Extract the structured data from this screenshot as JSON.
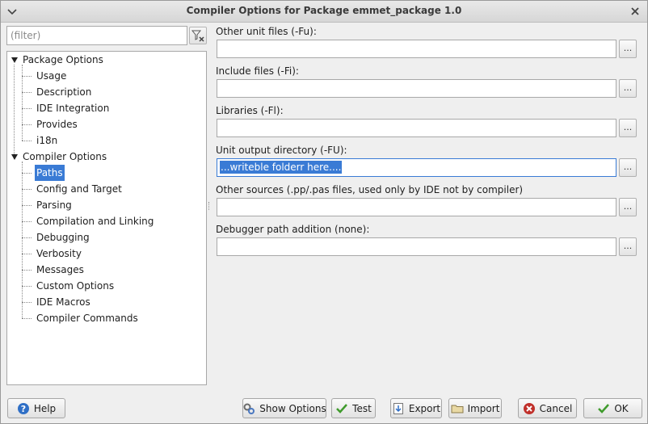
{
  "window": {
    "title": "Compiler Options for Package emmet_package 1.0"
  },
  "filter": {
    "placeholder": "(filter)",
    "value": ""
  },
  "tree": {
    "groups": [
      {
        "label": "Package Options",
        "expanded": true,
        "items": [
          "Usage",
          "Description",
          "IDE Integration",
          "Provides",
          "i18n"
        ]
      },
      {
        "label": "Compiler Options",
        "expanded": true,
        "items": [
          "Paths",
          "Config and Target",
          "Parsing",
          "Compilation and Linking",
          "Debugging",
          "Verbosity",
          "Messages",
          "Custom Options",
          "IDE Macros",
          "Compiler Commands"
        ]
      }
    ],
    "selected": "Paths"
  },
  "paths": {
    "fields": [
      {
        "label": "Other unit files (-Fu):",
        "value": ""
      },
      {
        "label": "Include files (-Fi):",
        "value": ""
      },
      {
        "label": "Libraries (-Fl):",
        "value": ""
      },
      {
        "label": "Unit output directory (-FU):",
        "value": "...writeble folderr here...."
      },
      {
        "label": "Other sources (.pp/.pas files, used only by IDE not by compiler)",
        "value": ""
      },
      {
        "label": "Debugger path addition (none):",
        "value": ""
      }
    ],
    "browse_label": "..."
  },
  "buttons": {
    "help": "Help",
    "show_options": "Show Options",
    "test": "Test",
    "export": "Export",
    "import": "Import",
    "cancel": "Cancel",
    "ok": "OK"
  },
  "icons": {
    "menu": "chevron-down-icon",
    "close": "close-icon",
    "filter_clear": "clear-filter-icon",
    "help": "help-icon",
    "show_options": "gear-icon",
    "test": "checkmark-icon",
    "export": "export-icon",
    "import": "folder-icon",
    "cancel": "cancel-icon",
    "ok": "checkmark-icon"
  },
  "colors": {
    "selection": "#3a7bd5",
    "help_blue": "#2f6fc6",
    "ok_green": "#3f9b2c",
    "cancel_red": "#c0302a"
  }
}
